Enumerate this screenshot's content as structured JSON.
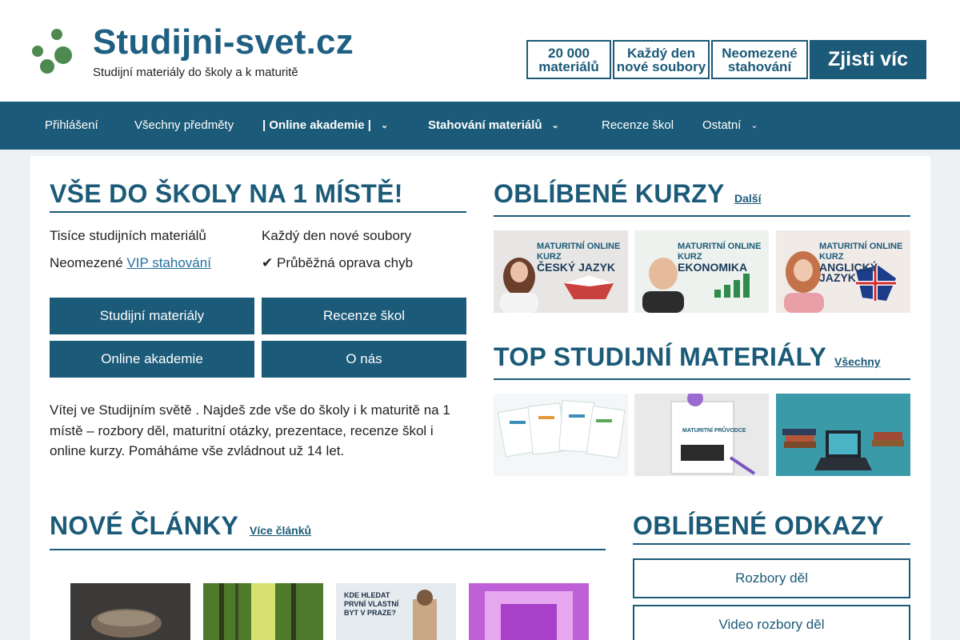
{
  "header": {
    "title": "Studijni-svet.cz",
    "tagline": "Studijní materiály do školy a k maturitě",
    "badges": [
      {
        "line1": "20 000",
        "line2": "materiálů"
      },
      {
        "line1": "Každý den",
        "line2": "nové soubory"
      },
      {
        "line1": "Neomezené",
        "line2": "stahování"
      }
    ],
    "cta": "Zjisti víc"
  },
  "nav": {
    "items": [
      {
        "label": " Přihlášení"
      },
      {
        "label": "Všechny předměty"
      },
      {
        "label": "|  Online akademie |"
      },
      {
        "label": " Stahování materiálů"
      },
      {
        "label": "Recenze škol"
      },
      {
        "label": "Ostatní"
      }
    ],
    "chevron": "⌄"
  },
  "hero": {
    "title": "VŠE DO ŠKOLY NA 1 MÍSTĚ!",
    "features": [
      {
        "icon": "",
        "text": "Tisíce studijních materiálů"
      },
      {
        "icon": "",
        "text": "Každý den nové soubory"
      },
      {
        "icon": "",
        "text": "Neomezené ",
        "link": "VIP stahování"
      },
      {
        "icon": "✔",
        "text": "Průběžná oprava chyb"
      }
    ],
    "buttons": [
      "Studijní materiály",
      "Recenze škol",
      "Online akademie",
      "O nás"
    ],
    "intro": "Vítej ve Studijním světě . Najdeš zde vše do školy i k maturitě na 1 místě – rozbory děl, maturitní otázky, prezentace, recenze škol i online kurzy. Pomáháme vše zvládnout už 14 let."
  },
  "courses": {
    "title": "OBLÍBENÉ KURZY",
    "more": " Další",
    "items": [
      {
        "tag": "MATURITNÍ ONLINE KURZ",
        "name": "ČESKÝ JAZYK"
      },
      {
        "tag": "MATURITNÍ ONLINE KURZ",
        "name": "EKONOMIKA"
      },
      {
        "tag": "MATURITNÍ ONLINE KURZ",
        "name": "ANGLICKÝ JAZYK"
      }
    ]
  },
  "materials": {
    "title": "TOP STUDIJNÍ MATERIÁLY",
    "more": " Všechny",
    "items": [
      {
        "name": "study-sheets"
      },
      {
        "name": "maturitni-pruvodce",
        "caption": "MATURITNÍ PRŮVODCE"
      },
      {
        "name": "books-laptop"
      }
    ]
  },
  "articles": {
    "title": "NOVÉ ČLÁNKY",
    "more": " Více článků",
    "items": [
      {
        "name": "article-1"
      },
      {
        "name": "article-2"
      },
      {
        "name": "article-3",
        "caption": "KDE HLEDAT PRVNÍ VLASTNÍ BYT V PRAZE?"
      },
      {
        "name": "article-4"
      }
    ]
  },
  "links": {
    "title": "OBLÍBENÉ ODKAZY",
    "items": [
      "Rozbory děl",
      "Video rozbory děl"
    ]
  },
  "colors": {
    "primary": "#1b5a78",
    "logo_green": "#4e8a4f",
    "background": "#eef1f3"
  }
}
